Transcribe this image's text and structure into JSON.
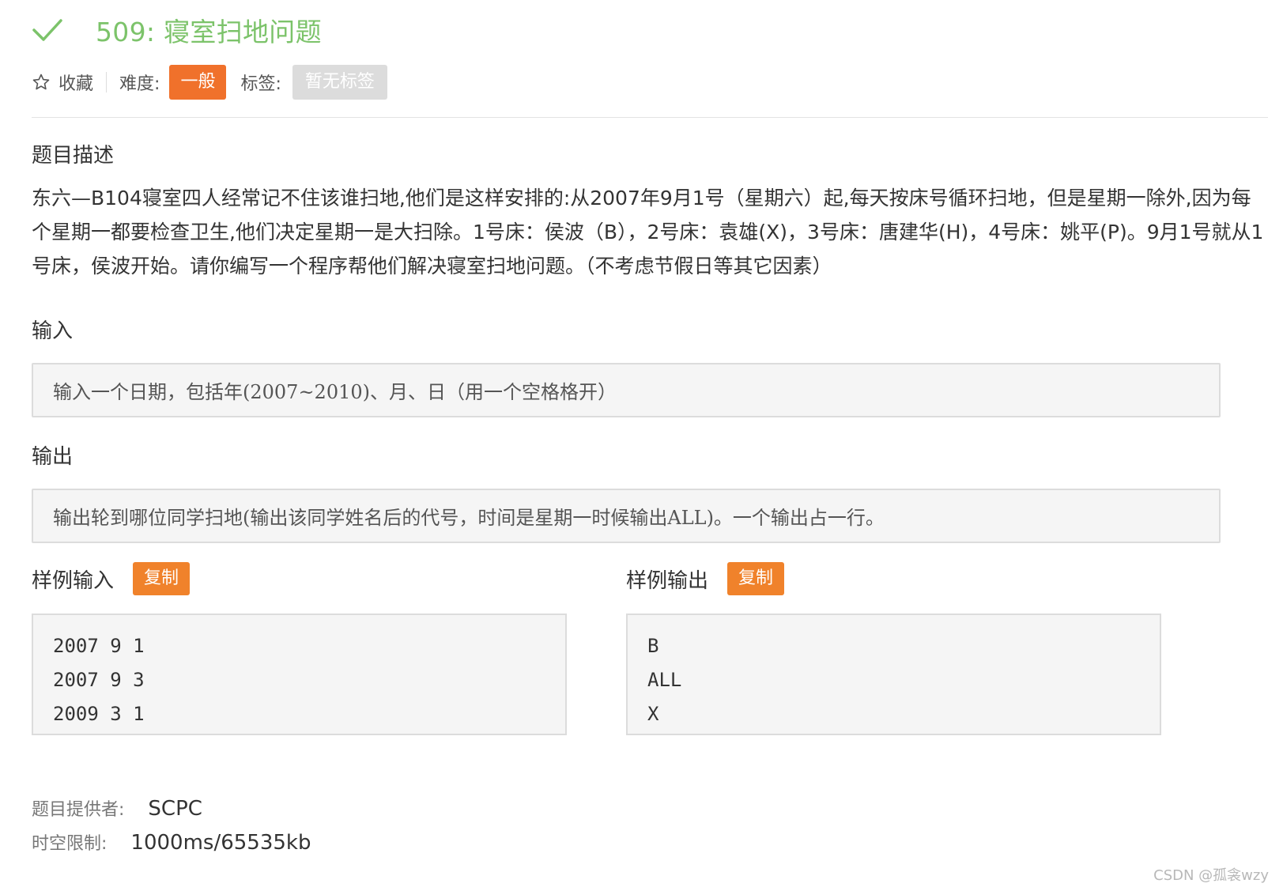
{
  "problem": {
    "title": "509: 寝室扫地问题",
    "status_icon": "check-icon",
    "accent_color": "#7cc36a"
  },
  "meta": {
    "favorite_label": "收藏",
    "difficulty_label": "难度:",
    "difficulty_value": "一般",
    "difficulty_color": "#f0712b",
    "tags_label": "标签:",
    "tags_value": "暂无标签"
  },
  "description": {
    "heading": "题目描述",
    "text": "东六—B104寝室四人经常记不住该谁扫地,他们是这样安排的:从2007年9月1号（星期六）起,每天按床号循环扫地，但是星期一除外,因为每个星期一都要检查卫生,他们决定星期一是大扫除。1号床：侯波（B），2号床：袁雄(X)，3号床：唐建华(H)，4号床：姚平(P)。9月1号就从1号床，侯波开始。请你编写一个程序帮他们解决寝室扫地问题。（不考虑节假日等其它因素）"
  },
  "input": {
    "heading": "输入",
    "text": "输入一个日期，包括年(2007~2010)、月、日（用一个空格格开）"
  },
  "output": {
    "heading": "输出",
    "text": "输出轮到哪位同学扫地(输出该同学姓名后的代号，时间是星期一时候输出ALL)。一个输出占一行。"
  },
  "sample_input": {
    "heading": "样例输入",
    "copy_label": "复制",
    "lines": [
      "2007 9 1",
      "2007 9 3",
      "2009 3 1"
    ]
  },
  "sample_output": {
    "heading": "样例输出",
    "copy_label": "复制",
    "lines": [
      "B",
      "ALL",
      "X"
    ]
  },
  "footer": {
    "provider_label": "题目提供者:",
    "provider_value": "SCPC",
    "limit_label": "时空限制:",
    "limit_value": "1000ms/65535kb"
  },
  "watermark": "CSDN @孤衾wzy"
}
